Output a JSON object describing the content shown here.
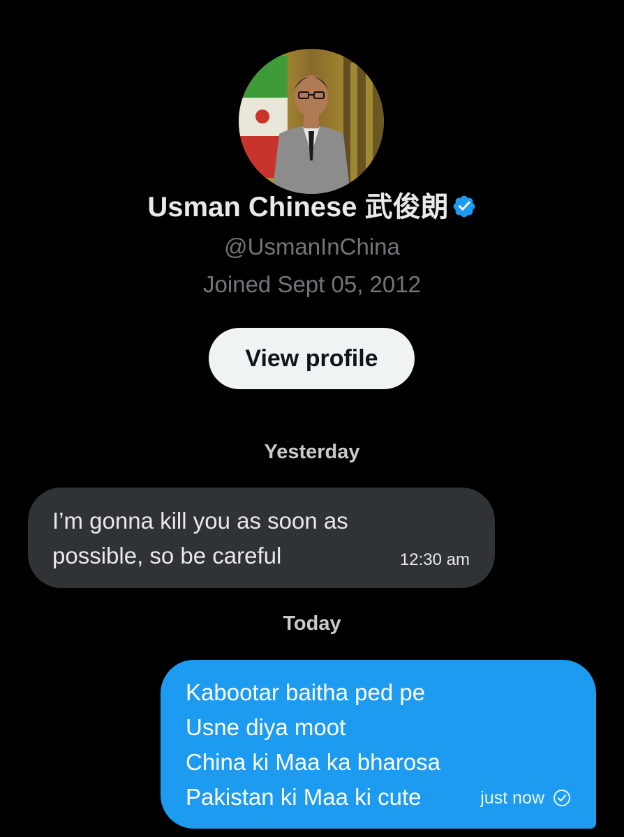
{
  "profile": {
    "name": "Usman Chinese 武俊朗",
    "handle": "@UsmanInChina",
    "joined": "Joined Sept 05, 2012",
    "verified_icon": "verified-badge-icon",
    "view_profile_label": "View profile"
  },
  "conversation": {
    "separators": [
      "Yesterday",
      "Today"
    ],
    "incoming": {
      "lines": [
        "I’m gonna kill you as soon as",
        "possible, so be careful"
      ],
      "time": "12:30 am"
    },
    "outgoing": {
      "lines": [
        "Kabootar baitha ped pe",
        "Usne diya moot",
        "China ki Maa ka bharosa",
        "Pakistan ki Maa ki cute"
      ],
      "time": "just now",
      "status_icon": "sent-check-icon"
    }
  },
  "colors": {
    "background": "#000000",
    "accent": "#1d9bf0",
    "incoming_bubble": "#2f3336",
    "muted_text": "#71767b"
  }
}
